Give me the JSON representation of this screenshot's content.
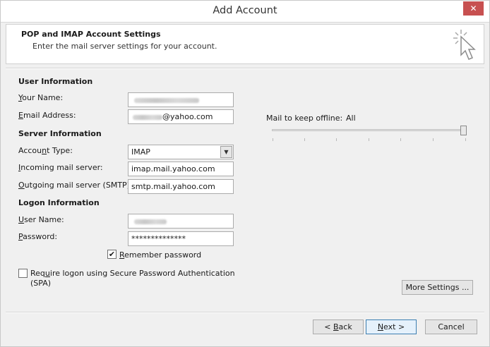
{
  "window": {
    "title": "Add Account",
    "close_glyph": "✕"
  },
  "header": {
    "title": "POP and IMAP Account Settings",
    "subtitle": "Enter the mail server settings for your account.",
    "icon": "wizard-cursor-icon"
  },
  "user_info": {
    "section_title": "User Information",
    "your_name_label": {
      "key": "Y",
      "rest": "our Name:"
    },
    "email_label": {
      "key": "E",
      "rest": "mail Address:"
    },
    "email_suffix": "@yahoo.com"
  },
  "server_info": {
    "section_title": "Server Information",
    "account_type_label": {
      "pre": "Accou",
      "key": "n",
      "rest": "t Type:"
    },
    "account_type_value": "IMAP",
    "incoming_label": {
      "key": "I",
      "rest": "ncoming mail server:"
    },
    "incoming_value": "imap.mail.yahoo.com",
    "outgoing_label": {
      "key": "O",
      "rest": "utgoing mail server (SMTP):"
    },
    "outgoing_value": "smtp.mail.yahoo.com"
  },
  "logon_info": {
    "section_title": "Logon Information",
    "username_label": {
      "key": "U",
      "rest": "ser Name:"
    },
    "password_label": {
      "key": "P",
      "rest": "assword:"
    },
    "password_value": "**************",
    "remember": {
      "checked": true,
      "check_glyph": "✔",
      "key": "R",
      "rest": "emember password"
    },
    "spa": {
      "checked": false,
      "pre": "Req",
      "key": "u",
      "rest": "ire logon using Secure Password Authentication",
      "line2": "(SPA)"
    }
  },
  "offline": {
    "label": "Mail to keep offline:",
    "value": "All",
    "slider_position": 1.0
  },
  "buttons": {
    "more_settings": "More Settings ...",
    "back": {
      "pre": "< ",
      "key": "B",
      "rest": "ack"
    },
    "next": {
      "pre": "",
      "key": "N",
      "rest": "ext >"
    },
    "cancel": "Cancel"
  }
}
